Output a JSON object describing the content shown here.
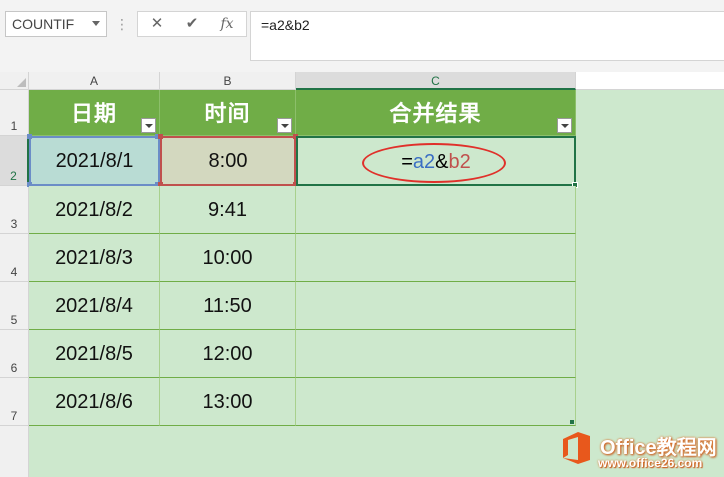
{
  "formula_bar": {
    "name_box": "COUNTIF",
    "more_glyph": "⋮",
    "cancel_glyph": "✕",
    "enter_glyph": "✔",
    "fx_glyph": "fx",
    "formula": "=a2&b2"
  },
  "columns": [
    "A",
    "B",
    "C"
  ],
  "rows": [
    "1",
    "2",
    "3",
    "4",
    "5",
    "6",
    "7"
  ],
  "header": {
    "date": "日期",
    "time": "时间",
    "result": "合并结果"
  },
  "data_rows": [
    {
      "date": "2021/8/1",
      "time": "8:00"
    },
    {
      "date": "2021/8/2",
      "time": "9:41"
    },
    {
      "date": "2021/8/3",
      "time": "10:00"
    },
    {
      "date": "2021/8/4",
      "time": "11:50"
    },
    {
      "date": "2021/8/5",
      "time": "12:00"
    },
    {
      "date": "2021/8/6",
      "time": "13:00"
    }
  ],
  "editing_cell": {
    "prefix": "=",
    "ref_a": "a2",
    "amp": "&",
    "ref_b": "b2"
  },
  "watermark": {
    "title": "Office教程网",
    "url": "www.office26.com"
  },
  "colors": {
    "header_green": "#70ad47",
    "table_fill": "#cde8cd",
    "ref_a_blue": "#3a6fc4",
    "ref_b_red": "#c0504d",
    "annotation_red": "#e0302a",
    "excel_green": "#217346",
    "watermark_orange": "#e06c1f"
  }
}
